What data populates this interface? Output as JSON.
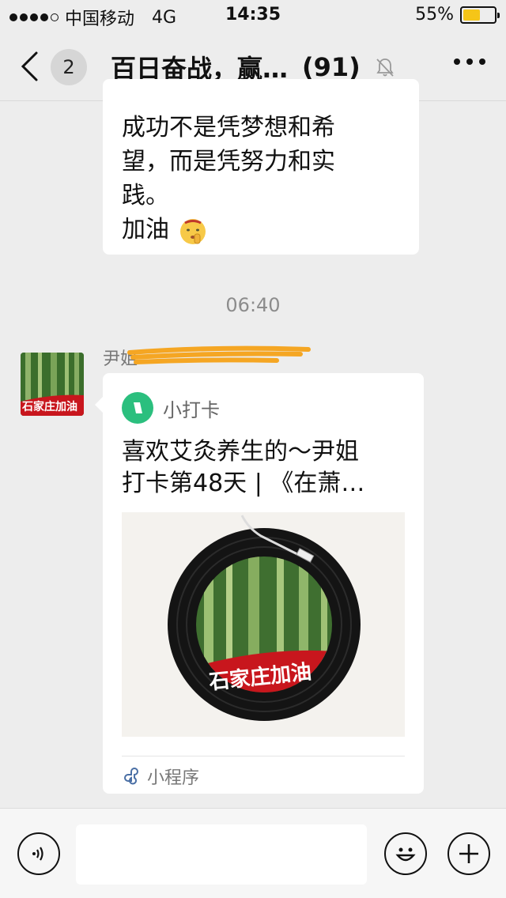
{
  "status_bar": {
    "carrier": "中国移动",
    "network": "4G",
    "time": "14:35",
    "battery_percent": "55%",
    "battery_level": 0.55,
    "signal_bars": 4
  },
  "nav": {
    "back_badge": "2",
    "title": "百日奋战，赢…",
    "member_count": "(91)",
    "icons": {
      "back": "chevron-left-icon",
      "mute": "bell-slash-icon",
      "more": "ellipsis-icon"
    }
  },
  "messages": {
    "text_message": {
      "lines": [
        "成功不是凭梦想和希",
        "望，而是凭努力和实",
        "践。",
        "加油"
      ],
      "emoji": "shushing-face-emoji"
    },
    "timestamp": "06:40",
    "sender": "尹姐",
    "mini_program_card": {
      "app_name": "小打卡",
      "title_lines": [
        "喜欢艾灸养生的～尹姐",
        "打卡第48天 | 《在萧…"
      ],
      "footer_label": "小程序",
      "image_caption": "石家庄加油"
    },
    "avatar_caption": "石家庄加油"
  },
  "input_bar": {
    "icons": {
      "voice": "voice-icon",
      "emoji": "emoji-icon",
      "plus": "plus-icon"
    },
    "input_value": ""
  },
  "colors": {
    "background": "#ededed",
    "bubble": "#ffffff",
    "miniprogram_green": "#2bbf7e",
    "battery_yellow": "#f5c518",
    "banner_red": "#c8161d"
  }
}
